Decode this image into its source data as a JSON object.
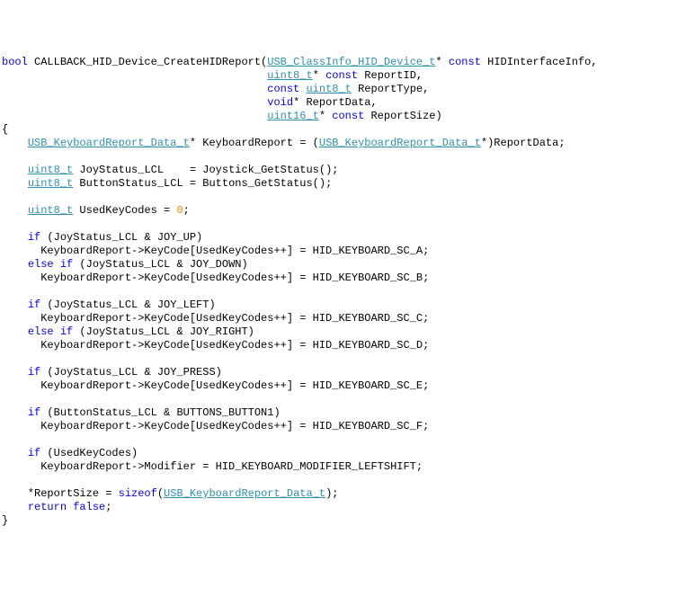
{
  "code": {
    "l01a": "bool",
    "l01b": " CALLBACK_HID_Device_CreateHIDReport(",
    "l01c": "USB_ClassInfo_HID_Device_t",
    "l01d": "* ",
    "l01e": "const",
    "l01f": " HIDInterfaceInfo,",
    "l02a": "                                         ",
    "l02b": "uint8_t",
    "l02c": "* ",
    "l02d": "const",
    "l02e": " ReportID,",
    "l03a": "                                         ",
    "l03b": "const",
    "l03c": " ",
    "l03d": "uint8_t",
    "l03e": " ReportType,",
    "l04a": "                                         ",
    "l04b": "void",
    "l04c": "* ReportData,",
    "l05a": "                                         ",
    "l05b": "uint16_t",
    "l05c": "* ",
    "l05d": "const",
    "l05e": " ReportSize)",
    "l06": "{",
    "l07a": "    ",
    "l07b": "USB_KeyboardReport_Data_t",
    "l07c": "* KeyboardReport = (",
    "l07d": "USB_KeyboardReport_Data_t",
    "l07e": "*)ReportData;",
    "l08": "",
    "l09a": "    ",
    "l09b": "uint8_t",
    "l09c": " JoyStatus_LCL    = Joystick_GetStatus();",
    "l10a": "    ",
    "l10b": "uint8_t",
    "l10c": " ButtonStatus_LCL = Buttons_GetStatus();",
    "l11": "",
    "l12a": "    ",
    "l12b": "uint8_t",
    "l12c": " UsedKeyCodes = ",
    "l12d": "0",
    "l12e": ";",
    "l13": "",
    "l14a": "    ",
    "l14b": "if",
    "l14c": " (JoyStatus_LCL & JOY_UP)",
    "l15": "      KeyboardReport->KeyCode[UsedKeyCodes++] = HID_KEYBOARD_SC_A;",
    "l16a": "    ",
    "l16b": "else",
    "l16c": " ",
    "l16d": "if",
    "l16e": " (JoyStatus_LCL & JOY_DOWN)",
    "l17": "      KeyboardReport->KeyCode[UsedKeyCodes++] = HID_KEYBOARD_SC_B;",
    "l18": "",
    "l19a": "    ",
    "l19b": "if",
    "l19c": " (JoyStatus_LCL & JOY_LEFT)",
    "l20": "      KeyboardReport->KeyCode[UsedKeyCodes++] = HID_KEYBOARD_SC_C;",
    "l21a": "    ",
    "l21b": "else",
    "l21c": " ",
    "l21d": "if",
    "l21e": " (JoyStatus_LCL & JOY_RIGHT)",
    "l22": "      KeyboardReport->KeyCode[UsedKeyCodes++] = HID_KEYBOARD_SC_D;",
    "l23": "",
    "l24a": "    ",
    "l24b": "if",
    "l24c": " (JoyStatus_LCL & JOY_PRESS)",
    "l25": "      KeyboardReport->KeyCode[UsedKeyCodes++] = HID_KEYBOARD_SC_E;",
    "l26": "",
    "l27a": "    ",
    "l27b": "if",
    "l27c": " (ButtonStatus_LCL & BUTTONS_BUTTON1)",
    "l28": "      KeyboardReport->KeyCode[UsedKeyCodes++] = HID_KEYBOARD_SC_F;",
    "l29": "",
    "l30a": "    ",
    "l30b": "if",
    "l30c": " (UsedKeyCodes)",
    "l31": "      KeyboardReport->Modifier = HID_KEYBOARD_MODIFIER_LEFTSHIFT;",
    "l32": "",
    "l33a": "    *ReportSize = ",
    "l33b": "sizeof",
    "l33c": "(",
    "l33d": "USB_KeyboardReport_Data_t",
    "l33e": ");",
    "l34a": "    ",
    "l34b": "return",
    "l34c": " ",
    "l34d": "false",
    "l34e": ";",
    "l35": "}"
  }
}
